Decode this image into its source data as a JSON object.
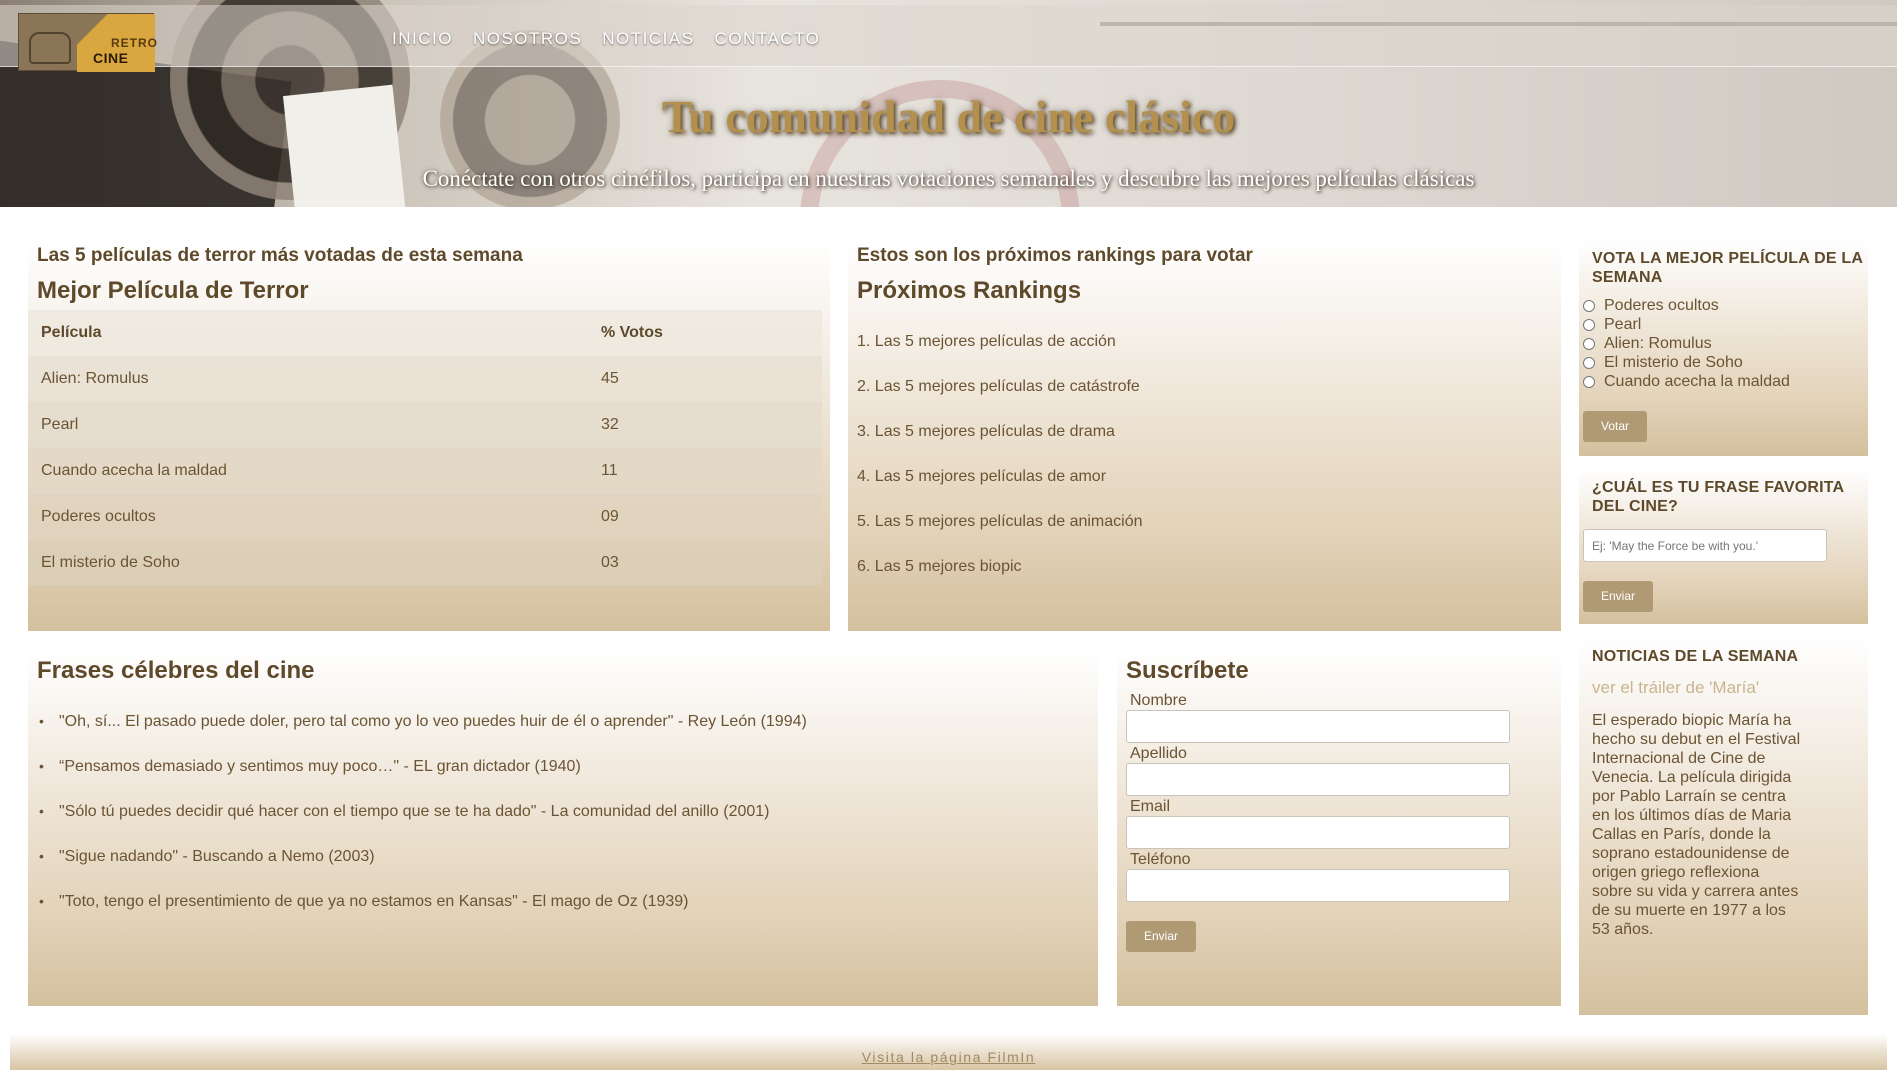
{
  "header": {
    "logo_top": "RETRO",
    "logo_bottom": "CINE",
    "nav": [
      "INICIO",
      "NOSOTROS",
      "NOTICIAS",
      "CONTACTO"
    ],
    "title": "Tu comunidad de cine clásico",
    "subtitle": "Conéctate con otros cinéfilos, participa en nuestras votaciones semanales y descubre las mejores películas clásicas"
  },
  "terror": {
    "kicker": "Las 5 películas de terror más votadas de esta semana",
    "title": "Mejor Película de Terror",
    "columns": [
      "Película",
      "% Votos"
    ],
    "rows": [
      [
        "Alien: Romulus",
        "45"
      ],
      [
        "Pearl",
        "32"
      ],
      [
        "Cuando acecha la maldad",
        "11"
      ],
      [
        "Poderes ocultos",
        "09"
      ],
      [
        "El misterio de Soho",
        "03"
      ]
    ]
  },
  "rankings": {
    "kicker": "Estos son los próximos rankings para votar",
    "title": "Próximos Rankings",
    "items": [
      "1.  Las 5 mejores películas de acción",
      "2.  Las 5 mejores películas de catástrofe",
      "3.  Las 5 mejores películas de drama",
      "4.  Las 5 mejores películas de amor",
      "5.  Las 5 mejores películas de animación",
      "6.  Las 5 mejores biopic"
    ]
  },
  "vote": {
    "title": "VOTA LA MEJOR PELÍCULA DE LA SEMANA",
    "options": [
      "Poderes ocultos",
      "Pearl",
      "Alien: Romulus",
      "El misterio de Soho",
      "Cuando acecha la maldad"
    ],
    "button": "Votar"
  },
  "quote_form": {
    "title": "¿CUÁL ES TU FRASE FAVORITA DEL CINE?",
    "placeholder": "Ej: 'May the Force be with you.'",
    "button": "Enviar"
  },
  "quotes": {
    "title": "Frases célebres del cine",
    "items": [
      "\"Oh, sí... El pasado puede doler, pero tal como yo lo veo puedes huir de él o aprender\" - Rey León (1994)",
      "“Pensamos demasiado y sentimos muy poco…\" - EL gran dictador (1940)",
      "\"Sólo tú puedes decidir qué hacer con el tiempo que se te ha dado\" - La comunidad del anillo (2001)",
      "\"Sigue nadando\" - Buscando a Nemo (2003)",
      "\"Toto, tengo el presentimiento de que ya no estamos en Kansas\" - El mago de Oz (1939)"
    ]
  },
  "subscribe": {
    "title": "Suscríbete",
    "fields": [
      "Nombre",
      "Apellido",
      "Email",
      "Teléfono"
    ],
    "button": "Enviar"
  },
  "news": {
    "title": "NOTICIAS DE LA SEMANA",
    "link": "ver el tráiler de 'María'",
    "body": "El esperado biopic María ha hecho su debut en el Festival Internacional de Cine de Venecia. La película dirigida por Pablo Larraín se centra en los últimos días de Maria Callas en París, donde la soprano estadounidense de origen griego reflexiona sobre su vida y carrera antes de su muerte en 1977 a los 53 años."
  },
  "footer": {
    "link": "Visita la página FilmIn"
  },
  "colors": {
    "accent": "#b09a73",
    "text": "#6b5433",
    "heading": "#5e4a2b",
    "title_gold": "#b3904e"
  }
}
